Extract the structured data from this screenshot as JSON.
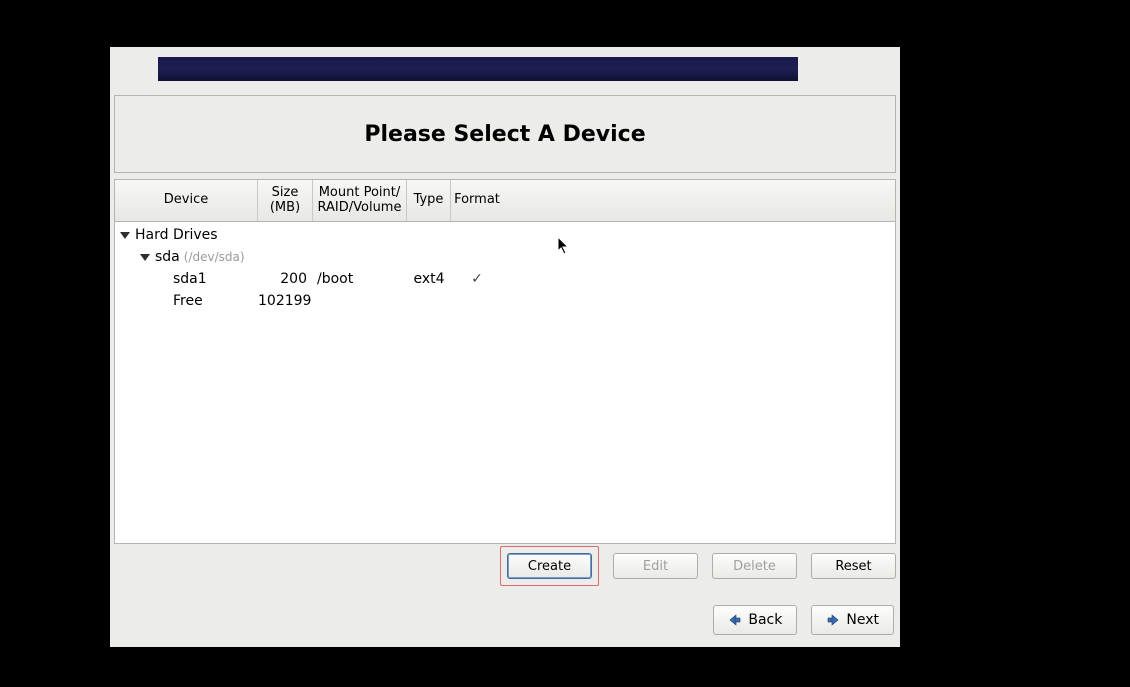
{
  "title": "Please Select A Device",
  "columns": {
    "device": "Device",
    "size": "Size\n(MB)",
    "mount": "Mount Point/\nRAID/Volume",
    "type": "Type",
    "format": "Format"
  },
  "tree": {
    "root_label": "Hard Drives",
    "disk": {
      "name": "sda",
      "path": "(/dev/sda)"
    },
    "rows": [
      {
        "device": "sda1",
        "size": "200",
        "mount": "/boot",
        "type": "ext4",
        "format_check": "✓"
      },
      {
        "device": "Free",
        "size": "102199",
        "mount": "",
        "type": "",
        "format_check": ""
      }
    ]
  },
  "actions": {
    "create": "Create",
    "edit": "Edit",
    "delete": "Delete",
    "reset": "Reset"
  },
  "nav": {
    "back": "Back",
    "next": "Next"
  }
}
